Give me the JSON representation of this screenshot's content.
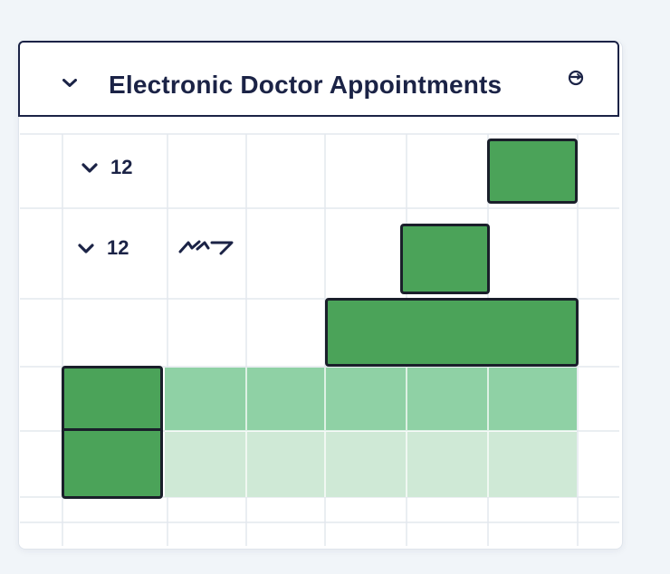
{
  "panel": {
    "title": "Electronic Doctor Appointments",
    "collapse_icon": "chevron-down-icon",
    "refresh_icon": "refresh-icon"
  },
  "rows": [
    {
      "label": "12",
      "icon": "chevron-down-icon"
    },
    {
      "label": "12",
      "icon": "chevron-down-icon",
      "extra_icon": "scribble-icon"
    }
  ],
  "colors": {
    "header_border": "#1b2346",
    "block_fill": "#4ba359",
    "block_border": "#1a1f2a",
    "band_mid": "#8fd1a5",
    "band_light": "#cfe9d6",
    "grid_line": "#e3e8ee"
  }
}
